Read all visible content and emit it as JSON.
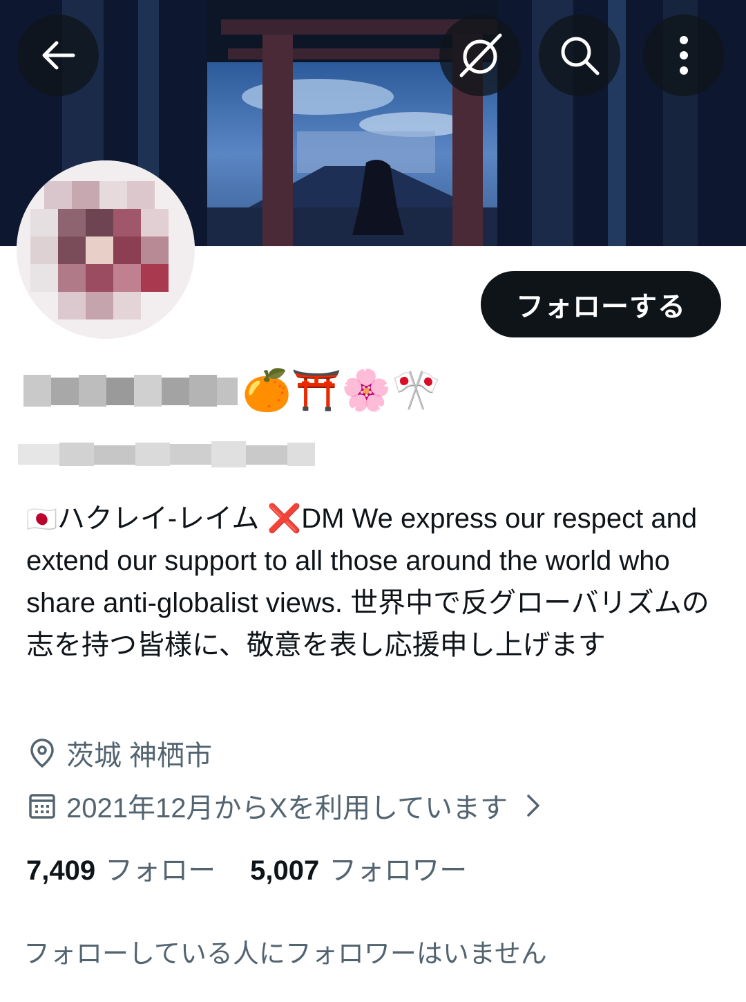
{
  "header": {
    "back_icon": "arrow-left-icon",
    "grok_icon": "grok-icon",
    "search_icon": "search-icon",
    "more_icon": "more-vertical-icon"
  },
  "profile": {
    "follow_label": "フォローする",
    "name_emojis": "🍊⛩️🌸🎌",
    "bio_flag": "🇯🇵",
    "bio_text": "ハクレイ-レイム ❌DM We express our respect and extend our support to all those around the world who share anti-globalist views. 世界中で反グローバリズムの志を持つ皆様に、敬意を表し応援申し上げます",
    "location": "茨城 神栖市",
    "joined": "2021年12月からXを利用しています",
    "following_count": "7,409",
    "following_label": "フォロー",
    "followers_count": "5,007",
    "followers_label": "フォロワー",
    "followers_you_know": "フォローしている人にフォロワーはいません"
  },
  "colors": {
    "primary_text": "#0f1419",
    "secondary_text": "#536471",
    "button_bg": "#0f1419"
  }
}
